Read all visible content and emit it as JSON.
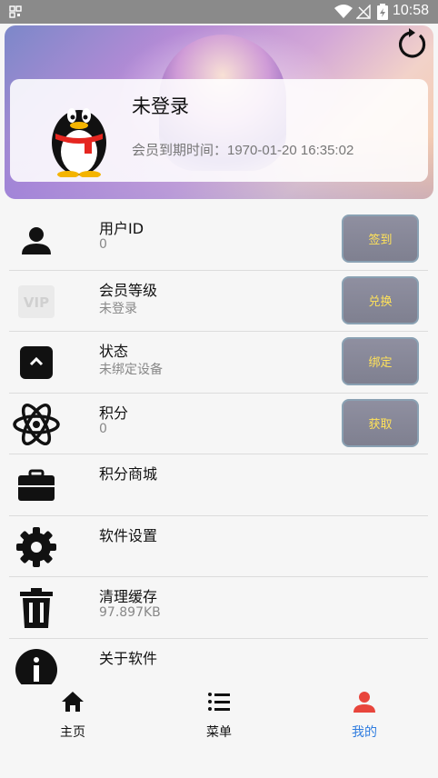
{
  "status": {
    "time": "10:58"
  },
  "profile": {
    "username": "未登录",
    "expire_text": "会员到期时间：1970-01-20 16:35:02"
  },
  "rows": [
    {
      "title": "用户ID",
      "sub": "0",
      "button": "签到",
      "icon": "user-icon"
    },
    {
      "title": "会员等级",
      "sub": "未登录",
      "button": "兑换",
      "icon": "vip-icon"
    },
    {
      "title": "状态",
      "sub": "未绑定设备",
      "button": "绑定",
      "icon": "collapse-up-icon"
    },
    {
      "title": "积分",
      "sub": "0",
      "button": "获取",
      "icon": "atom-icon"
    },
    {
      "title": "积分商城",
      "sub": "",
      "icon": "briefcase-icon"
    },
    {
      "title": "软件设置",
      "sub": "",
      "icon": "gear-icon"
    },
    {
      "title": "清理缓存",
      "sub": "97.897KB",
      "icon": "trash-icon"
    },
    {
      "title": "关于软件",
      "sub": "",
      "icon": "info-icon"
    }
  ],
  "nav": {
    "home": "主页",
    "menu": "菜单",
    "mine": "我的",
    "active_color": "#2f7cdf"
  }
}
